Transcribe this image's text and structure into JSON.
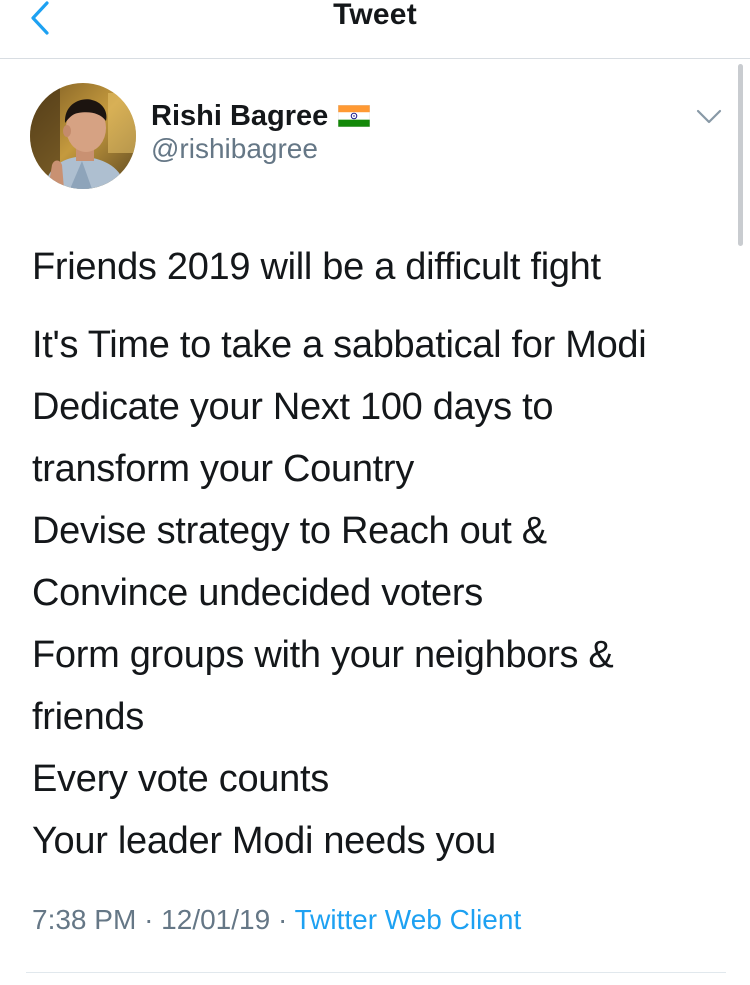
{
  "nav": {
    "title": "Tweet",
    "back_icon": "chevron-left-icon",
    "accent": "#1da1f2"
  },
  "author": {
    "display_name": "Rishi Bagree",
    "handle": "@rishibagree",
    "flag_icon": "india-flag-icon",
    "avatar_icon": "avatar"
  },
  "tweet": {
    "lines": [
      "Friends 2019 will be a difficult fight",
      "It's Time to take a sabbatical for Modi",
      "Dedicate your Next 100 days to",
      "transform your Country",
      "Devise strategy to Reach out &",
      "Convince undecided voters",
      "Form groups with your neighbors &",
      "friends",
      "Every vote counts",
      "Your leader Modi needs you"
    ],
    "time": "7:38 PM",
    "separator": "·",
    "date": "12/01/19",
    "source": "Twitter Web Client"
  },
  "colors": {
    "text": "#14171a",
    "secondary": "#657786",
    "link": "#1da1f2",
    "divider": "#e1e8ed"
  }
}
